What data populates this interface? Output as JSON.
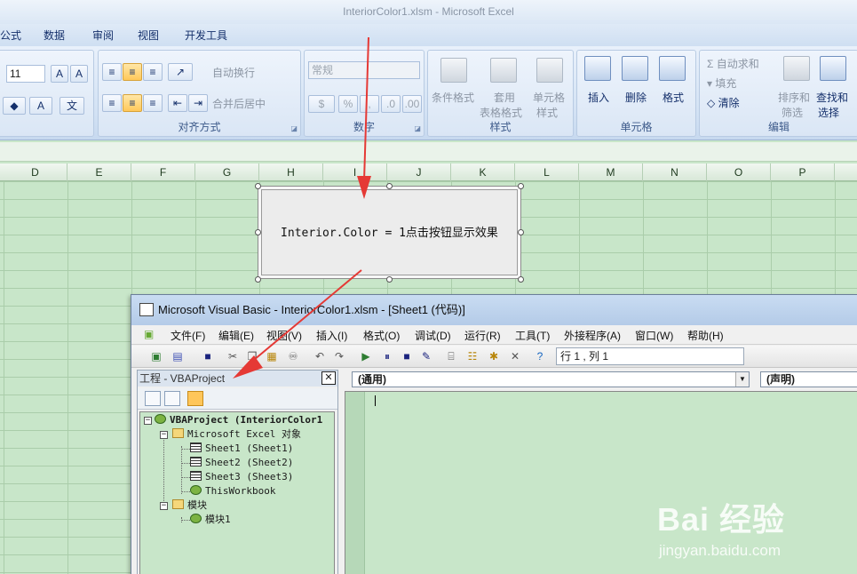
{
  "excel": {
    "window_title": "InteriorColor1.xlsm - Microsoft Excel",
    "tabs": [
      "公式",
      "数据",
      "审阅",
      "视图",
      "开发工具"
    ],
    "font_size": "11",
    "wrap_text": "自动换行",
    "merge_center": "合并后居中",
    "number_format": "常规",
    "styles": {
      "conditional": "条件格式",
      "table_a": "套用",
      "table_b": "表格格式",
      "cell_a": "单元格",
      "cell_b": "样式"
    },
    "cells": {
      "insert": "插入",
      "delete": "删除",
      "format": "格式"
    },
    "editing": {
      "autosum": "自动求和",
      "fill": "填充",
      "clear": "清除",
      "sort_a": "排序和",
      "sort_b": "筛选",
      "find_a": "查找和",
      "find_b": "选择"
    },
    "group_labels": {
      "alignment": "对齐方式",
      "number": "数字",
      "styles": "样式",
      "cells": "单元格",
      "editing": "编辑"
    },
    "columns": [
      "D",
      "E",
      "F",
      "G",
      "H",
      "I",
      "J",
      "K",
      "L",
      "M",
      "N",
      "O",
      "P"
    ],
    "button_text": "Interior.Color = 1点击按钮显示效果"
  },
  "vbe": {
    "title": "Microsoft Visual Basic - InteriorColor1.xlsm - [Sheet1 (代码)]",
    "menu": [
      "文件(F)",
      "编辑(E)",
      "视图(V)",
      "插入(I)",
      "格式(O)",
      "调试(D)",
      "运行(R)",
      "工具(T)",
      "外接程序(A)",
      "窗口(W)",
      "帮助(H)"
    ],
    "position": "行 1 , 列 1",
    "project_pane_title": "工程 - VBAProject",
    "close_glyph": "✕",
    "tree": {
      "root": "VBAProject (InteriorColor1",
      "excel_objects": "Microsoft Excel 对象",
      "sheets": [
        "Sheet1 (Sheet1)",
        "Sheet2 (Sheet2)",
        "Sheet3 (Sheet3)"
      ],
      "workbook": "ThisWorkbook",
      "modules_folder": "模块",
      "module": "模块1"
    },
    "object_combo": "(通用)",
    "proc_combo": "(声明)"
  },
  "watermark": {
    "logo": "Bai 经验",
    "url": "jingyan.baidu.com"
  },
  "colors": {
    "sheet_bg": "#c8e6c9",
    "arrow": "#e53935",
    "ribbon": "#dbe7f5"
  }
}
